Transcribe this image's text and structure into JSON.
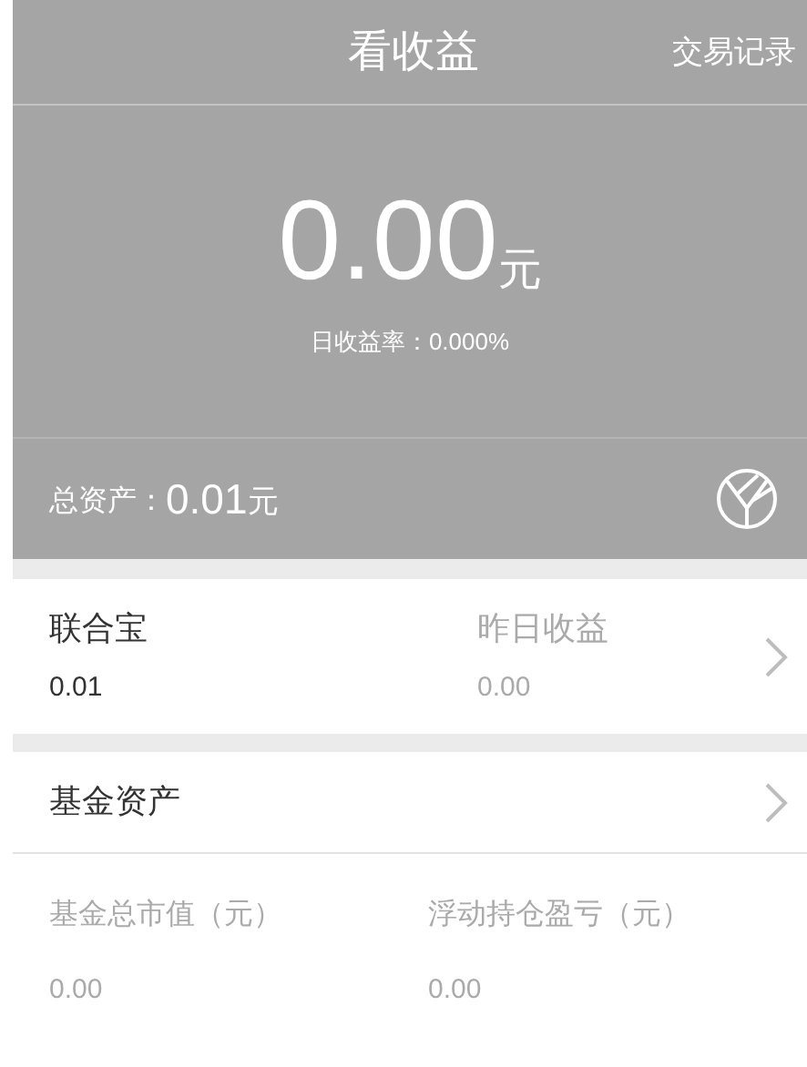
{
  "header": {
    "title": "看收益",
    "action": "交易记录"
  },
  "summary": {
    "amount": "0.00",
    "unit": "元",
    "rate_label": "日收益率：",
    "rate": "0.000%"
  },
  "total": {
    "label": "总资产：",
    "amount": "0.01",
    "unit": "元"
  },
  "lianhebao": {
    "name": "联合宝",
    "value": "0.01",
    "yesterday_label": "昨日收益",
    "yesterday_value": "0.00"
  },
  "funds": {
    "title": "基金资产",
    "stats": [
      {
        "label": "基金总市值（元）",
        "value": "0.00"
      },
      {
        "label": "浮动持仓盈亏（元）",
        "value": "0.00"
      }
    ]
  }
}
